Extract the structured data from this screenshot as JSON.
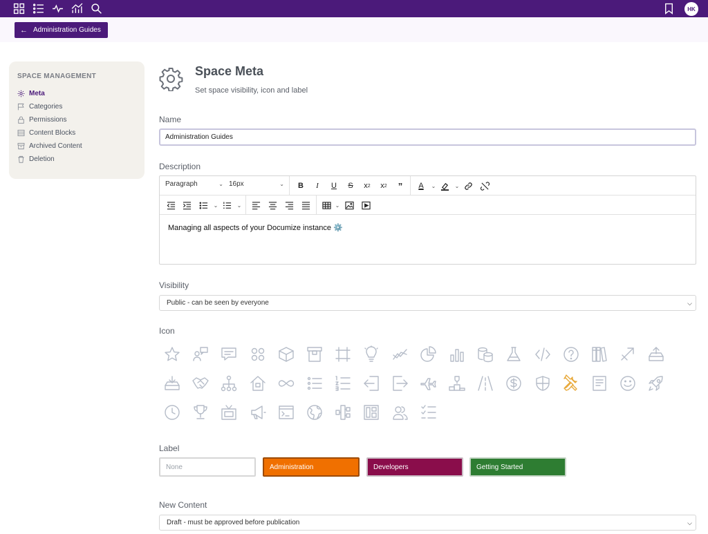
{
  "topbar": {
    "nav_icons": [
      "grid-icon",
      "list-icon",
      "activity-icon",
      "chart-icon",
      "search-icon"
    ],
    "bookmark_icon": "bookmark-icon",
    "avatar_initials": "HK",
    "color": "#4b1a7a"
  },
  "back_button": {
    "label": "Administration Guides",
    "icon": "arrow-left-icon"
  },
  "sidebar": {
    "title": "SPACE MANAGEMENT",
    "items": [
      {
        "label": "Meta",
        "icon": "gear-icon",
        "active": true
      },
      {
        "label": "Categories",
        "icon": "flag-icon"
      },
      {
        "label": "Permissions",
        "icon": "lock-icon"
      },
      {
        "label": "Content Blocks",
        "icon": "blocks-icon"
      },
      {
        "label": "Archived Content",
        "icon": "archive-icon"
      },
      {
        "label": "Deletion",
        "icon": "trash-icon"
      }
    ]
  },
  "header": {
    "title": "Space Meta",
    "subtitle": "Set space visibility, icon and label",
    "icon": "gear-icon"
  },
  "name": {
    "label": "Name",
    "value": "Administration Guides"
  },
  "description": {
    "label": "Description",
    "toolbar": {
      "block_format": "Paragraph",
      "font_size": "16px"
    },
    "content": "Managing all aspects of your Documize instance ⚙️"
  },
  "visibility": {
    "label": "Visibility",
    "value": "Public - can be seen by everyone"
  },
  "icon_section": {
    "label": "Icon",
    "selected": "tools-icon",
    "rows": [
      [
        "star-icon",
        "user-chat-icon",
        "message-icon",
        "apps-icon",
        "box-icon",
        "archive-box-icon",
        "crop-icon",
        "bulb-icon",
        "trend-icon",
        "pie-icon",
        "bars-icon",
        "coins-icon",
        "flask-icon",
        "code-icon",
        "question-icon",
        "books-icon",
        "transfer-icon",
        "upload-tray-icon"
      ],
      [
        "download-tray-icon",
        "handshake-icon",
        "hierarchy-icon",
        "home-icon",
        "infinity-icon",
        "list-icon",
        "numbered-list-icon",
        "sign-in-icon",
        "sign-out-icon",
        "plane-icon",
        "podium-icon",
        "road-icon",
        "dollar-icon",
        "shield-icon",
        "tools-icon",
        "document-icon",
        "smile-icon",
        "rocket-icon"
      ],
      [
        "clock-icon",
        "trophy-icon",
        "tv-icon",
        "megaphone-icon",
        "terminal-icon",
        "globe-icon",
        "split-icon",
        "layout-icon",
        "users-icon",
        "checklist-icon"
      ]
    ]
  },
  "label_section": {
    "label": "Label",
    "options": [
      {
        "name": "None",
        "color": "#ffffff",
        "text_color": "#9aa0a8",
        "border": "#d6d6d6"
      },
      {
        "name": "Administration",
        "color": "#f07000",
        "text_color": "#ffffff",
        "border": "#9c4a00"
      },
      {
        "name": "Developers",
        "color": "#8a0d4b",
        "text_color": "#ffffff",
        "border": "#c9bcc4"
      },
      {
        "name": "Getting Started",
        "color": "#2e7d32",
        "text_color": "#ffffff",
        "border": "#c4d4c4"
      }
    ]
  },
  "new_content": {
    "label": "New Content",
    "value": "Draft - must be approved before publication"
  }
}
